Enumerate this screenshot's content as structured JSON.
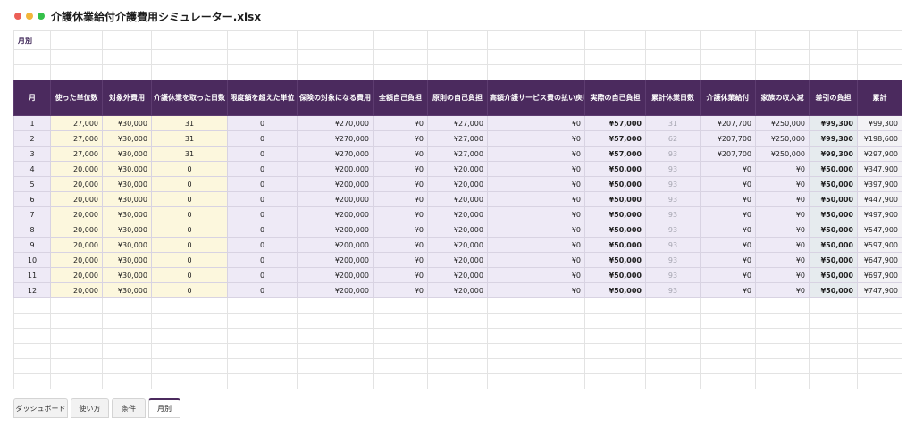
{
  "window": {
    "title": "介護休業給付介護費用シミュレーター.xlsx"
  },
  "sheet_title": "月別",
  "headers": [
    "月",
    "使った単位数",
    "対象外費用",
    "介護休業を取った日数",
    "限度額を超えた単位",
    "保険の対象になる費用",
    "全額自己負担",
    "原則の自己負担",
    "高額介護サービス費の払い戻し",
    "実際の自己負担",
    "累計休業日数",
    "介護休業給付",
    "家族の収入減",
    "差引の負担",
    "累計"
  ],
  "rows": [
    [
      "1",
      "27,000",
      "¥30,000",
      "31",
      "0",
      "¥270,000",
      "¥0",
      "¥27,000",
      "¥0",
      "¥57,000",
      "31",
      "¥207,700",
      "¥250,000",
      "¥99,300",
      "¥99,300"
    ],
    [
      "2",
      "27,000",
      "¥30,000",
      "31",
      "0",
      "¥270,000",
      "¥0",
      "¥27,000",
      "¥0",
      "¥57,000",
      "62",
      "¥207,700",
      "¥250,000",
      "¥99,300",
      "¥198,600"
    ],
    [
      "3",
      "27,000",
      "¥30,000",
      "31",
      "0",
      "¥270,000",
      "¥0",
      "¥27,000",
      "¥0",
      "¥57,000",
      "93",
      "¥207,700",
      "¥250,000",
      "¥99,300",
      "¥297,900"
    ],
    [
      "4",
      "20,000",
      "¥30,000",
      "0",
      "0",
      "¥200,000",
      "¥0",
      "¥20,000",
      "¥0",
      "¥50,000",
      "93",
      "¥0",
      "¥0",
      "¥50,000",
      "¥347,900"
    ],
    [
      "5",
      "20,000",
      "¥30,000",
      "0",
      "0",
      "¥200,000",
      "¥0",
      "¥20,000",
      "¥0",
      "¥50,000",
      "93",
      "¥0",
      "¥0",
      "¥50,000",
      "¥397,900"
    ],
    [
      "6",
      "20,000",
      "¥30,000",
      "0",
      "0",
      "¥200,000",
      "¥0",
      "¥20,000",
      "¥0",
      "¥50,000",
      "93",
      "¥0",
      "¥0",
      "¥50,000",
      "¥447,900"
    ],
    [
      "7",
      "20,000",
      "¥30,000",
      "0",
      "0",
      "¥200,000",
      "¥0",
      "¥20,000",
      "¥0",
      "¥50,000",
      "93",
      "¥0",
      "¥0",
      "¥50,000",
      "¥497,900"
    ],
    [
      "8",
      "20,000",
      "¥30,000",
      "0",
      "0",
      "¥200,000",
      "¥0",
      "¥20,000",
      "¥0",
      "¥50,000",
      "93",
      "¥0",
      "¥0",
      "¥50,000",
      "¥547,900"
    ],
    [
      "9",
      "20,000",
      "¥30,000",
      "0",
      "0",
      "¥200,000",
      "¥0",
      "¥20,000",
      "¥0",
      "¥50,000",
      "93",
      "¥0",
      "¥0",
      "¥50,000",
      "¥597,900"
    ],
    [
      "10",
      "20,000",
      "¥30,000",
      "0",
      "0",
      "¥200,000",
      "¥0",
      "¥20,000",
      "¥0",
      "¥50,000",
      "93",
      "¥0",
      "¥0",
      "¥50,000",
      "¥647,900"
    ],
    [
      "11",
      "20,000",
      "¥30,000",
      "0",
      "0",
      "¥200,000",
      "¥0",
      "¥20,000",
      "¥0",
      "¥50,000",
      "93",
      "¥0",
      "¥0",
      "¥50,000",
      "¥697,900"
    ],
    [
      "12",
      "20,000",
      "¥30,000",
      "0",
      "0",
      "¥200,000",
      "¥0",
      "¥20,000",
      "¥0",
      "¥50,000",
      "93",
      "¥0",
      "¥0",
      "¥50,000",
      "¥747,900"
    ]
  ],
  "tabs": [
    {
      "label": "ダッシュボード",
      "active": false
    },
    {
      "label": "使い方",
      "active": false
    },
    {
      "label": "条件",
      "active": false
    },
    {
      "label": "月別",
      "active": true
    }
  ],
  "colors": {
    "header_bg": "#4b2a5e",
    "input_bg": "#fcf7dd",
    "row_bg": "#eeeaf6",
    "diff_bg": "#e6ebee"
  }
}
